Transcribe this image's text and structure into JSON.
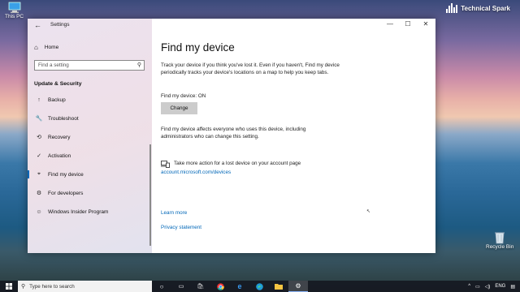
{
  "desktop": {
    "this_pc_label": "This PC",
    "recycle_label": "Recycle Bin",
    "watermark": "Technical Spark"
  },
  "window": {
    "title": "Settings",
    "controls": {
      "minimize": "—",
      "maximize": "☐",
      "close": "✕"
    }
  },
  "sidebar": {
    "home_label": "Home",
    "search_placeholder": "Find a setting",
    "section_title": "Update & Security",
    "items": [
      {
        "label": "Backup",
        "icon": "↑"
      },
      {
        "label": "Troubleshoot",
        "icon": "🔧"
      },
      {
        "label": "Recovery",
        "icon": "⟲"
      },
      {
        "label": "Activation",
        "icon": "✓"
      },
      {
        "label": "Find my device",
        "icon": "⌖"
      },
      {
        "label": "For developers",
        "icon": "⚙"
      },
      {
        "label": "Windows Insider Program",
        "icon": "☺"
      }
    ],
    "active_index": 4
  },
  "content": {
    "title": "Find my device",
    "intro": "Track your device if you think you've lost it. Even if you haven't, Find my device periodically tracks your device's locations on a map to help you keep tabs.",
    "status": "Find my device: ON",
    "change_button": "Change",
    "note": "Find my device affects everyone who uses this device, including administrators who can change this setting.",
    "account_action": "Take more action for a lost device on your account page",
    "account_link": "account.microsoft.com/devices",
    "learn_more": "Learn more",
    "privacy": "Privacy statement"
  },
  "taskbar": {
    "search_placeholder": "Type here to search",
    "language": "ENG"
  },
  "colors": {
    "accent": "#0067b8",
    "button": "#cccccc",
    "taskbar": "#161a22"
  }
}
